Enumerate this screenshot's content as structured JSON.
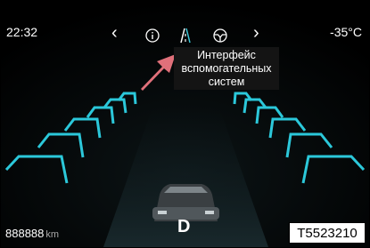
{
  "status": {
    "time": "22:32",
    "temperature": "-35°C"
  },
  "nav": {
    "prev_icon": "chevron-left-icon",
    "next_icon": "chevron-right-icon",
    "icons": [
      "info-icon",
      "assistance-lane-icon",
      "steering-wheel-icon"
    ],
    "active": "assistance-lane-icon"
  },
  "tooltip": {
    "lines": [
      "Интерфейс",
      "вспомогательных",
      "систем"
    ]
  },
  "bottom": {
    "odometer": "888888",
    "odometer_unit": "km",
    "gear": "D"
  },
  "figure_code": "T5523210",
  "colors": {
    "lane_glow": "#2ed3e6",
    "arrow": "#e0707a",
    "active_icon": "#3cc8d8"
  }
}
